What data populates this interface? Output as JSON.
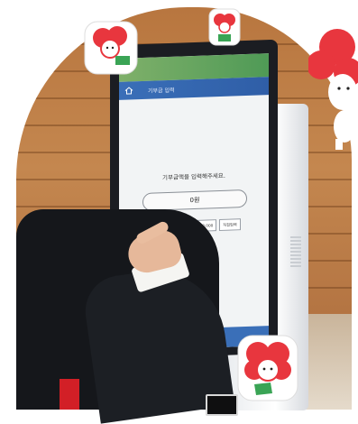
{
  "kiosk_screen": {
    "header_title": "기부금 입력",
    "prompt": "기부금액을 입력해주세요.",
    "amount_value": "0원",
    "quick_amounts": [
      "10,000",
      "30,000",
      "50,000",
      "100,000",
      "직접입력"
    ]
  },
  "colors": {
    "header_blue": "#3a6fb8",
    "header_green": "#4f9a56",
    "mascot_red": "#e8363e",
    "wall_wood": "#b8763f"
  },
  "icons": [
    "home-icon",
    "mascot-flower-character"
  ]
}
